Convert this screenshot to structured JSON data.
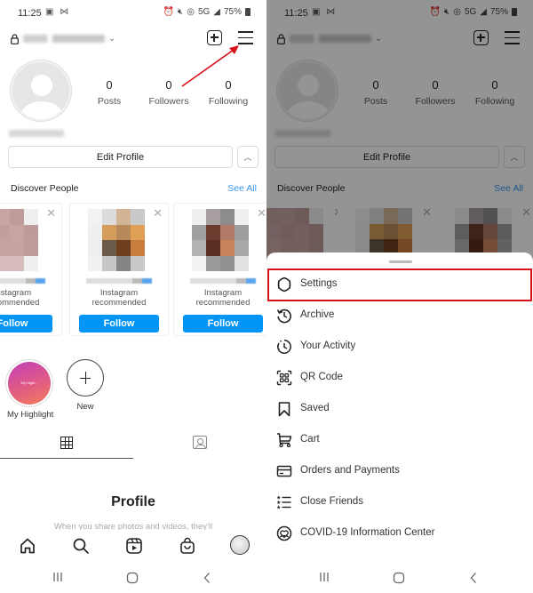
{
  "status_bar": {
    "time": "11:25",
    "left_icons": [
      "gallery-icon",
      "mail-icon"
    ],
    "right_icons": [
      "alarm-icon",
      "mute-icon",
      "hotspot-icon"
    ],
    "network": "5G",
    "battery": "75%"
  },
  "header": {
    "username": "(blurred)",
    "icons": [
      "lock-icon",
      "chevron-down-icon",
      "new-post-icon",
      "menu-icon"
    ]
  },
  "profile": {
    "stats": [
      {
        "value": "0",
        "label": "Posts"
      },
      {
        "value": "0",
        "label": "Followers"
      },
      {
        "value": "0",
        "label": "Following"
      }
    ],
    "edit_profile_label": "Edit Profile",
    "expand_icon": "chevron-up-icon"
  },
  "discover": {
    "title": "Discover People",
    "see_all": "See All",
    "cards": [
      {
        "subtitle_line1": "Instagram",
        "subtitle_line2": "recommended",
        "button": "Follow",
        "pixels": [
          "#c7a3a3",
          "#c8a4a4",
          "#bf9c9b",
          "#eeeeee",
          "#c9a5a5",
          "#c49e9e",
          "#c9a3a3",
          "#bf9a9a",
          "#cda9a9",
          "#c7a0a0",
          "#c8a2a2",
          "#bf9b9b",
          "#dfc8c8",
          "#d9bcbc",
          "#d8bcbc",
          "#efefef"
        ]
      },
      {
        "subtitle_line1": "Instagram",
        "subtitle_line2": "recommended",
        "button": "Follow",
        "pixels": [
          "#f2f2f2",
          "#dcdcdc",
          "#d1b596",
          "#c9c9c9",
          "#efefef",
          "#d49d5b",
          "#b88a5a",
          "#df9f55",
          "#eeeeee",
          "#6a5a47",
          "#6e3f1f",
          "#c97d3e",
          "#f1f1f1",
          "#c7c7c7",
          "#858585",
          "#c9c9c9"
        ]
      },
      {
        "subtitle_line1": "Instagram",
        "subtitle_line2": "recommended",
        "button": "Follow",
        "pixels": [
          "#efefef",
          "#a8a0a0",
          "#8c8c8c",
          "#efefef",
          "#a29f9f",
          "#6b3d2f",
          "#b07a66",
          "#9d9d9d",
          "#b5b3b3",
          "#5a2e22",
          "#c9825c",
          "#a9a7a7",
          "#f2f2f2",
          "#9a9a9a",
          "#909090",
          "#e2e2e2"
        ]
      }
    ]
  },
  "highlights": [
    {
      "label": "My Highlight",
      "cover_text": "My Highl..."
    },
    {
      "label": "New"
    }
  ],
  "tabs": [
    "grid-icon",
    "tagged-icon"
  ],
  "empty_state": {
    "title": "Profile",
    "subtitle": "When you share photos and videos, they'll"
  },
  "bottom_nav": [
    "home-icon",
    "search-icon",
    "reels-icon",
    "shop-icon",
    "profile-icon"
  ],
  "system_nav": [
    "recents-icon",
    "home-button-icon",
    "back-icon"
  ],
  "menu_sheet": {
    "items": [
      {
        "label": "Settings",
        "icon": "settings-icon",
        "highlighted": true
      },
      {
        "label": "Archive",
        "icon": "archive-icon"
      },
      {
        "label": "Your Activity",
        "icon": "activity-icon"
      },
      {
        "label": "QR Code",
        "icon": "qr-code-icon"
      },
      {
        "label": "Saved",
        "icon": "bookmark-icon"
      },
      {
        "label": "Cart",
        "icon": "cart-icon"
      },
      {
        "label": "Orders and Payments",
        "icon": "card-icon"
      },
      {
        "label": "Close Friends",
        "icon": "close-friends-icon"
      },
      {
        "label": "COVID-19 Information Center",
        "icon": "covid-info-icon"
      }
    ]
  },
  "colors": {
    "accent": "#0095f6",
    "link": "#3897f0",
    "annotation": "#d9111a"
  }
}
